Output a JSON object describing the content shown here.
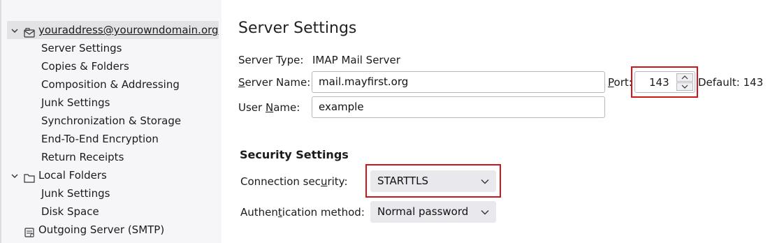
{
  "sidebar": {
    "account": "youraddress@yourowndomain.org",
    "account_items": [
      "Server Settings",
      "Copies & Folders",
      "Composition & Addressing",
      "Junk Settings",
      "Synchronization & Storage",
      "End-To-End Encryption",
      "Return Receipts"
    ],
    "local_folders": "Local Folders",
    "local_items": [
      "Junk Settings",
      "Disk Space"
    ],
    "outgoing": "Outgoing Server (SMTP)"
  },
  "main": {
    "title": "Server Settings",
    "server_type_label": "Server Type:",
    "server_type_value": "IMAP Mail Server",
    "server_name_label_pre": "",
    "server_name_label_key": "S",
    "server_name_label_post": "erver Name:",
    "server_name_value": "mail.mayfirst.org",
    "port_label_pre": "",
    "port_label_key": "P",
    "port_label_post": "ort:",
    "port_value": "143",
    "port_default": "Default: 143",
    "user_name_label_pre": "User ",
    "user_name_label_key": "N",
    "user_name_label_post": "ame:",
    "user_name_value": "example",
    "security_title": "Security Settings",
    "conn_security_label_pre": "Connection sec",
    "conn_security_label_key": "u",
    "conn_security_label_post": "rity:",
    "conn_security_value": "STARTTLS",
    "auth_label_pre": "Authen",
    "auth_label_key": "t",
    "auth_label_post": "ication method:",
    "auth_value": "Normal password"
  },
  "colors": {
    "highlight": "#d0141b",
    "sidebar_bg": "#f6f6f8",
    "selected_bg": "#e3e3e6"
  },
  "icons": [
    "chevron-down-icon",
    "mail-account-icon",
    "folder-icon",
    "outgoing-server-icon"
  ]
}
